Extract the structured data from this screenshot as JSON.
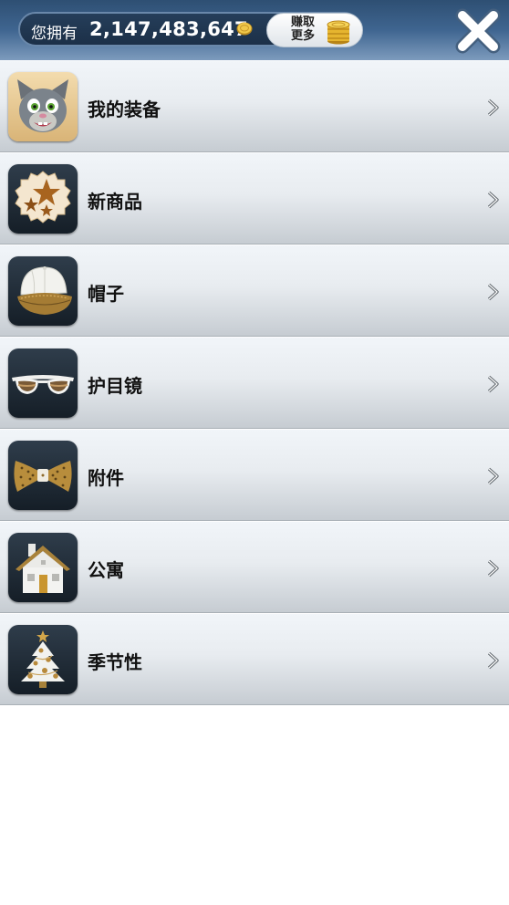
{
  "header": {
    "you_have_label": "您拥有",
    "coin_count": "2,147,483,647",
    "earn_more_label_line1": "赚取",
    "earn_more_label_line2": "更多",
    "close_icon": "close-x-icon",
    "coin_icon": "gold-coin-icon"
  },
  "menu": {
    "items": [
      {
        "label": "我的装备",
        "icon": "tom-cat-icon"
      },
      {
        "label": "新商品",
        "icon": "new-star-badge-icon"
      },
      {
        "label": "帽子",
        "icon": "baseball-cap-icon"
      },
      {
        "label": "护目镜",
        "icon": "sunglasses-icon"
      },
      {
        "label": "附件",
        "icon": "bow-tie-icon"
      },
      {
        "label": "公寓",
        "icon": "house-icon"
      },
      {
        "label": "季节性",
        "icon": "christmas-tree-icon"
      }
    ]
  },
  "colors": {
    "header_top": "#2e4f73",
    "header_bottom": "#7d9bbd",
    "row_top": "#f1f5f9",
    "row_bottom": "#c6ccd2",
    "label_text": "#111111",
    "coin_gold": "#e0b43a"
  }
}
